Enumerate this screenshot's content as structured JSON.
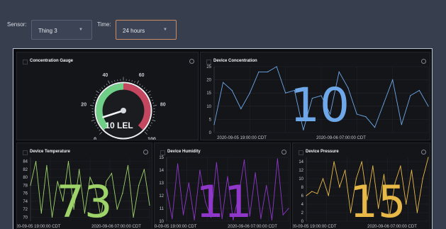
{
  "filters": {
    "sensor_label": "Sensor:",
    "sensor_value": "Thing 3",
    "time_label": "Time:",
    "time_value": "24 hours",
    "time_accent": "#c98a64"
  },
  "panels": {
    "gauge": {
      "title": "Concentration Gauge",
      "value_label": "10 LEL",
      "value": 10,
      "min": 0,
      "max": 100,
      "ticks": [
        "0",
        "20",
        "40",
        "60",
        "80",
        "100"
      ],
      "colors": {
        "green": "#6fcf87",
        "red": "#c4475f"
      }
    },
    "concentration": {
      "title": "Device Concentration",
      "big_value": "10",
      "color": "#6ea8e8",
      "yticks": [
        "0",
        "5",
        "10",
        "15",
        "20",
        "25"
      ],
      "xticks": [
        "2020-09-05 19:00:00 CDT",
        "2020-09-06 07:00:00 CDT"
      ]
    },
    "temperature": {
      "title": "Device Temperature",
      "big_value": "73",
      "color": "#9ed36a",
      "yticks": [
        "70",
        "72",
        "74",
        "76",
        "78",
        "80",
        "82",
        "84"
      ],
      "xticks": [
        "20-09-05 19:00:00 CDT",
        "2020-09-06 07:00:00 CDT"
      ]
    },
    "humidity": {
      "title": "Device Humidity",
      "big_value": "11",
      "color": "#8e37c8",
      "yticks": [
        "10",
        "11",
        "12",
        "13",
        "14",
        "15"
      ],
      "xticks": [
        "20-09-05 19:00:00 CDT",
        "2020-09-06 07:00:00 CDT"
      ]
    },
    "pressure": {
      "title": "Device Pressure",
      "big_value": "15",
      "color": "#e8b947",
      "yticks": [
        "0",
        "2",
        "4",
        "6",
        "8",
        "10",
        "12",
        "14"
      ],
      "xticks": [
        "20-09-05 19:00:00 CDT",
        "2020-09-06 07:00:00 CDT"
      ]
    }
  },
  "chart_data": [
    {
      "type": "line",
      "title": "Device Concentration",
      "ylim": [
        0,
        25
      ],
      "x": [
        "2020-09-05 13:00",
        "2020-09-05 14:00",
        "2020-09-05 15:00",
        "2020-09-05 16:00",
        "2020-09-05 17:00",
        "2020-09-05 18:00",
        "2020-09-05 19:00",
        "2020-09-05 20:00",
        "2020-09-05 21:00",
        "2020-09-05 22:00",
        "2020-09-05 23:00",
        "2020-09-06 00:00",
        "2020-09-06 01:00",
        "2020-09-06 02:00",
        "2020-09-06 03:00",
        "2020-09-06 04:00",
        "2020-09-06 05:00",
        "2020-09-06 06:00",
        "2020-09-06 07:00",
        "2020-09-06 08:00",
        "2020-09-06 09:00",
        "2020-09-06 10:00",
        "2020-09-06 11:00",
        "2020-09-06 12:00",
        "2020-09-06 13:00"
      ],
      "series": [
        {
          "values": [
            3,
            19,
            16,
            9,
            15,
            23,
            23,
            25,
            15,
            16,
            1,
            13,
            14,
            7,
            23,
            17,
            7,
            6,
            2,
            11,
            20,
            3,
            14,
            16,
            10
          ]
        }
      ]
    },
    {
      "type": "line",
      "title": "Device Temperature",
      "ylim": [
        69,
        85
      ],
      "x": [
        "2020-09-05 14:00",
        "2020-09-05 15:00",
        "2020-09-05 16:00",
        "2020-09-05 17:00",
        "2020-09-05 18:00",
        "2020-09-05 19:00",
        "2020-09-05 20:00",
        "2020-09-05 21:00",
        "2020-09-05 22:00",
        "2020-09-05 23:00",
        "2020-09-06 00:00",
        "2020-09-06 01:00",
        "2020-09-06 02:00",
        "2020-09-06 03:00",
        "2020-09-06 04:00",
        "2020-09-06 05:00",
        "2020-09-06 06:00",
        "2020-09-06 07:00",
        "2020-09-06 08:00",
        "2020-09-06 09:00",
        "2020-09-06 10:00",
        "2020-09-06 11:00",
        "2020-09-06 12:00"
      ],
      "series": [
        {
          "values": [
            78,
            84,
            71,
            83,
            70,
            79,
            74,
            84,
            72,
            82,
            71,
            80,
            77,
            70,
            79,
            81,
            72,
            76,
            83,
            70,
            78,
            82,
            73
          ]
        }
      ]
    },
    {
      "type": "line",
      "title": "Device Humidity",
      "ylim": [
        10,
        15
      ],
      "x": [
        "2020-09-05 14:00",
        "2020-09-05 15:00",
        "2020-09-05 16:00",
        "2020-09-05 17:00",
        "2020-09-05 18:00",
        "2020-09-05 19:00",
        "2020-09-05 20:00",
        "2020-09-05 21:00",
        "2020-09-05 22:00",
        "2020-09-05 23:00",
        "2020-09-06 00:00",
        "2020-09-06 01:00",
        "2020-09-06 02:00",
        "2020-09-06 03:00",
        "2020-09-06 04:00",
        "2020-09-06 05:00",
        "2020-09-06 06:00",
        "2020-09-06 07:00",
        "2020-09-06 08:00",
        "2020-09-06 09:00",
        "2020-09-06 10:00",
        "2020-09-06 11:00",
        "2020-09-06 12:00"
      ],
      "series": [
        {
          "values": [
            12.5,
            10.2,
            14.5,
            10.5,
            13,
            10.1,
            14,
            11.5,
            10.3,
            14.6,
            10.2,
            13.5,
            10.1,
            12,
            14.8,
            10.4,
            13.8,
            10.2,
            12.8,
            10.1,
            14.9,
            10.5,
            11
          ]
        }
      ]
    },
    {
      "type": "line",
      "title": "Device Pressure",
      "ylim": [
        0,
        15
      ],
      "x": [
        "2020-09-05 14:00",
        "2020-09-05 15:00",
        "2020-09-05 16:00",
        "2020-09-05 17:00",
        "2020-09-05 18:00",
        "2020-09-05 19:00",
        "2020-09-05 20:00",
        "2020-09-05 21:00",
        "2020-09-05 22:00",
        "2020-09-05 23:00",
        "2020-09-06 00:00",
        "2020-09-06 01:00",
        "2020-09-06 02:00",
        "2020-09-06 03:00",
        "2020-09-06 04:00",
        "2020-09-06 05:00",
        "2020-09-06 06:00",
        "2020-09-06 07:00",
        "2020-09-06 08:00",
        "2020-09-06 09:00",
        "2020-09-06 10:00",
        "2020-09-06 11:00",
        "2020-09-06 12:00"
      ],
      "series": [
        {
          "values": [
            6,
            7,
            6.5,
            10,
            6,
            14,
            8,
            12,
            2,
            10,
            14,
            5,
            13,
            3,
            11,
            1,
            9,
            13,
            4,
            12,
            2,
            10,
            15
          ]
        }
      ]
    }
  ]
}
